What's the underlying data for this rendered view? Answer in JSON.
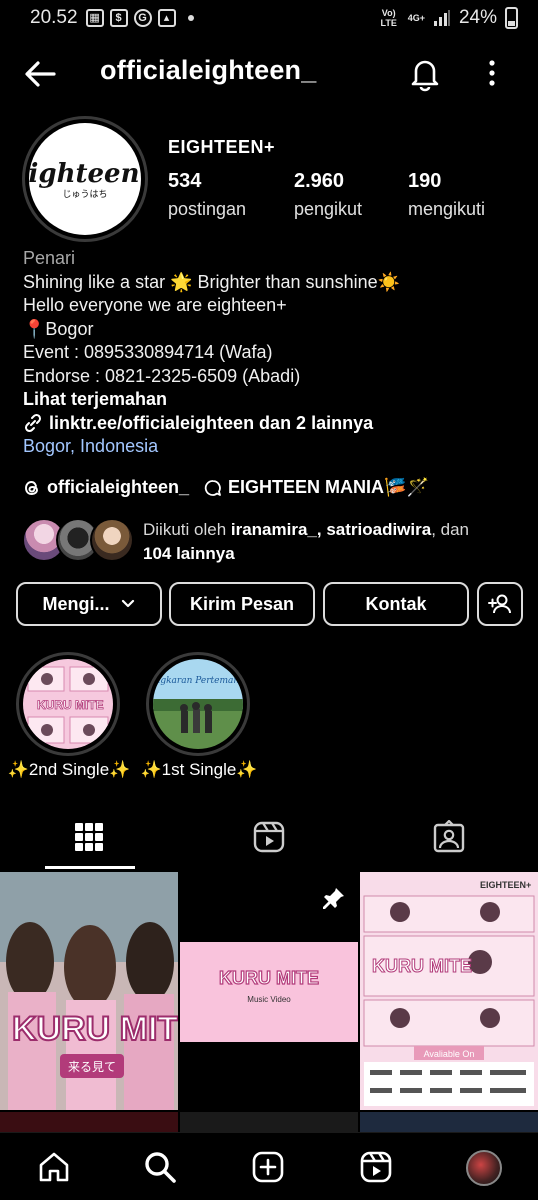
{
  "status_bar": {
    "time": "20.52",
    "network": "Vo) LTE",
    "network_gen": "4G+",
    "battery": "24%"
  },
  "header": {
    "username": "officialeighteen_"
  },
  "profile": {
    "display_name": "EIGHTEEN+",
    "avatar_logo_text": "Eighteen+",
    "avatar_logo_sub": "じゅうはち",
    "stats": [
      {
        "value": "534",
        "label": "postingan"
      },
      {
        "value": "2.960",
        "label": "pengikut"
      },
      {
        "value": "190",
        "label": "mengikuti"
      }
    ],
    "category": "Penari",
    "bio_lines": [
      "Shining like a star 🌟 Brighter than sunshine☀️",
      "Hello everyone we are eighteen+",
      "📍Bogor",
      "Event : 0895330894714 (Wafa)",
      "Endorse : 0821-2325-6509 (Abadi)"
    ],
    "translate_label": "Lihat terjemahan",
    "link_text": "linktr.ee/officialeighteen dan 2 lainnya",
    "location": "Bogor, Indonesia",
    "threads_handle": "officialeighteen_",
    "channel_name": "EIGHTEEN MANIA🎏🪄",
    "followed_by": {
      "prefix": "Diikuti oleh ",
      "names": "iranamira_, satrioadiwira",
      "middle": ", dan",
      "rest": "104 lainnya"
    }
  },
  "buttons": {
    "following": "Mengi...",
    "message": "Kirim Pesan",
    "contact": "Kontak"
  },
  "highlights": [
    {
      "label": "✨2nd Single✨",
      "cover_text": "KURU MITE"
    },
    {
      "label": "✨1st Single✨",
      "cover_text": "Lingkaran Pertemanan"
    }
  ],
  "posts": [
    {
      "title": "KURU MITE",
      "subtitle": "来る見て"
    },
    {
      "title": "KURU MITE",
      "subtitle": "Music Video"
    },
    {
      "title": "KURU MITE",
      "subtitle": "Avaliable On",
      "header_text": "EIGHTEEN+"
    }
  ],
  "colors": {
    "background": "#000000",
    "link_blue": "#a3c7ff",
    "pink": "#f4b9d4",
    "border": "#dcdcdc"
  },
  "icons": [
    "back-arrow-icon",
    "bell-icon",
    "more-vertical-icon",
    "grid-icon",
    "reels-icon",
    "tagged-icon",
    "home-icon",
    "search-icon",
    "add-icon",
    "reels-nav-icon",
    "threads-icon",
    "link-icon",
    "pin-icon",
    "add-person-icon",
    "chevron-down-icon"
  ]
}
